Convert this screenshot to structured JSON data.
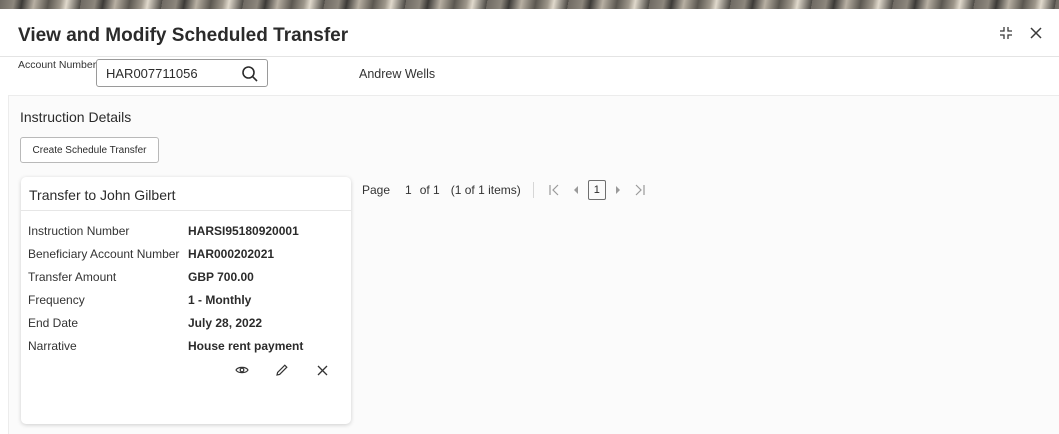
{
  "window": {
    "title": "View and Modify Scheduled Transfer",
    "maximize_icon": "maximize-icon",
    "close_icon": "close-icon"
  },
  "account": {
    "label": "Account Number",
    "value": "HAR007711056",
    "search_icon": "search-icon",
    "holder_name": "Andrew Wells"
  },
  "section": {
    "title": "Instruction Details",
    "create_button": "Create Schedule Transfer"
  },
  "card": {
    "title": "Transfer to John Gilbert",
    "rows": [
      {
        "label": "Instruction Number",
        "value": "HARSI95180920001"
      },
      {
        "label": "Beneficiary Account Number",
        "value": "HAR000202021"
      },
      {
        "label": "Transfer Amount",
        "value": "GBP 700.00"
      },
      {
        "label": "Frequency",
        "value": "1 - Monthly"
      },
      {
        "label": "End Date",
        "value": "July 28, 2022"
      },
      {
        "label": "Narrative",
        "value": "House rent payment"
      }
    ],
    "actions": [
      "view-icon",
      "edit-icon",
      "delete-icon"
    ]
  },
  "pagination": {
    "page_label": "Page",
    "current_page": "1",
    "of_label": "of 1",
    "items_label": "(1 of 1 items)",
    "current_button": "1"
  },
  "colors": {
    "text": "#2b2b2b",
    "border": "#9a9a9a",
    "pager_disabled": "#9a9a9a"
  }
}
